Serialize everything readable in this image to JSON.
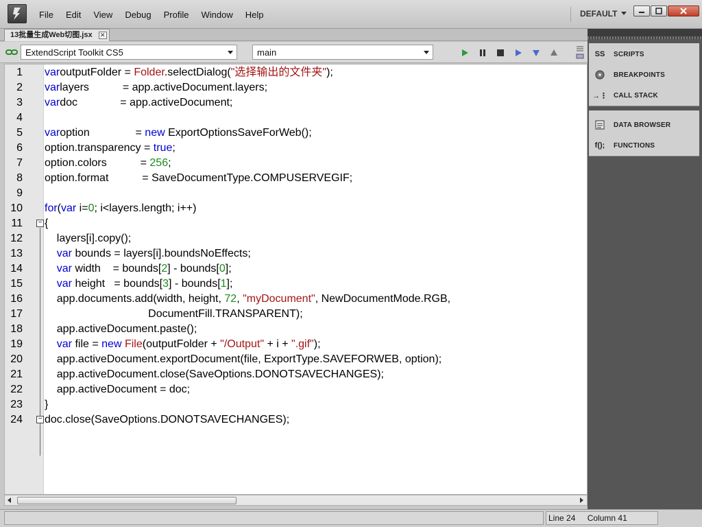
{
  "window": {
    "menu": [
      "File",
      "Edit",
      "View",
      "Debug",
      "Profile",
      "Window",
      "Help"
    ],
    "workspace": "DEFAULT"
  },
  "document": {
    "tab_title": "13批量生成Web切图.jsx",
    "target_app": "ExtendScript Toolkit CS5",
    "engine": "main"
  },
  "editor": {
    "lines": [
      {
        "n": "1",
        "tokens": [
          [
            "kw",
            "var"
          ],
          [
            "",
            "outputFolder = "
          ],
          [
            "cls",
            "Folder"
          ],
          [
            "",
            ".selectDialog("
          ],
          [
            "str",
            "\"选择输出的文件夹\""
          ],
          [
            "",
            ");"
          ]
        ]
      },
      {
        "n": "2",
        "tokens": [
          [
            "kw",
            "var"
          ],
          [
            "",
            "layers           = app.activeDocument.layers;"
          ]
        ]
      },
      {
        "n": "3",
        "tokens": [
          [
            "kw",
            "var"
          ],
          [
            "",
            "doc              = app.activeDocument;"
          ]
        ]
      },
      {
        "n": "4",
        "tokens": []
      },
      {
        "n": "5",
        "tokens": [
          [
            "kw",
            "var"
          ],
          [
            "",
            "option               = "
          ],
          [
            "kw",
            "new"
          ],
          [
            "",
            " ExportOptionsSaveForWeb();"
          ]
        ]
      },
      {
        "n": "6",
        "tokens": [
          [
            "",
            "option.transparency = "
          ],
          [
            "kw",
            "true"
          ],
          [
            "",
            ";"
          ]
        ]
      },
      {
        "n": "7",
        "tokens": [
          [
            "",
            "option.colors           = "
          ],
          [
            "num",
            "256"
          ],
          [
            "",
            ";"
          ]
        ]
      },
      {
        "n": "8",
        "tokens": [
          [
            "",
            "option.format           = SaveDocumentType.COMPUSERVEGIF;"
          ]
        ]
      },
      {
        "n": "9",
        "tokens": []
      },
      {
        "n": "10",
        "tokens": [
          [
            "kw",
            "for"
          ],
          [
            "",
            "("
          ],
          [
            "kw",
            "var"
          ],
          [
            "",
            " i="
          ],
          [
            "num",
            "0"
          ],
          [
            "",
            "; i<layers.length; i++)"
          ]
        ]
      },
      {
        "n": "11",
        "tokens": [
          [
            "",
            "{"
          ]
        ]
      },
      {
        "n": "12",
        "tokens": [
          [
            "",
            "    layers[i].copy();"
          ]
        ]
      },
      {
        "n": "13",
        "tokens": [
          [
            "",
            "    "
          ],
          [
            "kw",
            "var"
          ],
          [
            "",
            " bounds = layers[i].boundsNoEffects;"
          ]
        ]
      },
      {
        "n": "14",
        "tokens": [
          [
            "",
            "    "
          ],
          [
            "kw",
            "var"
          ],
          [
            "",
            " width    = bounds["
          ],
          [
            "num",
            "2"
          ],
          [
            "",
            "] - bounds["
          ],
          [
            "num",
            "0"
          ],
          [
            "",
            "];"
          ]
        ]
      },
      {
        "n": "15",
        "tokens": [
          [
            "",
            "    "
          ],
          [
            "kw",
            "var"
          ],
          [
            "",
            " height   = bounds["
          ],
          [
            "num",
            "3"
          ],
          [
            "",
            "] - bounds["
          ],
          [
            "num",
            "1"
          ],
          [
            "",
            "];"
          ]
        ]
      },
      {
        "n": "16",
        "tokens": [
          [
            "",
            "    app.documents.add(width, height, "
          ],
          [
            "num",
            "72"
          ],
          [
            "",
            ", "
          ],
          [
            "str",
            "\"myDocument\""
          ],
          [
            "",
            ", NewDocumentMode.RGB,"
          ]
        ]
      },
      {
        "n": "17",
        "tokens": [
          [
            "",
            "                                  DocumentFill.TRANSPARENT);"
          ]
        ]
      },
      {
        "n": "18",
        "tokens": [
          [
            "",
            "    app.activeDocument.paste();"
          ]
        ]
      },
      {
        "n": "19",
        "tokens": [
          [
            "",
            "    "
          ],
          [
            "kw",
            "var"
          ],
          [
            "",
            " file = "
          ],
          [
            "kw",
            "new"
          ],
          [
            "",
            " "
          ],
          [
            "cls",
            "File"
          ],
          [
            "",
            "(outputFolder + "
          ],
          [
            "str",
            "\"/Output\""
          ],
          [
            "",
            " + i + "
          ],
          [
            "str",
            "\".gif\""
          ],
          [
            "",
            ");"
          ]
        ]
      },
      {
        "n": "20",
        "tokens": [
          [
            "",
            "    app.activeDocument.exportDocument(file, ExportType.SAVEFORWEB, option);"
          ]
        ]
      },
      {
        "n": "21",
        "tokens": [
          [
            "",
            "    app.activeDocument.close(SaveOptions.DONOTSAVECHANGES);"
          ]
        ]
      },
      {
        "n": "22",
        "tokens": [
          [
            "",
            "    app.activeDocument = doc;"
          ]
        ]
      },
      {
        "n": "23",
        "tokens": [
          [
            "",
            "}"
          ]
        ]
      },
      {
        "n": "24",
        "tokens": [
          [
            "",
            "doc.close(SaveOptions.DONOTSAVECHANGES);"
          ]
        ]
      }
    ]
  },
  "panels": {
    "group1": [
      {
        "label": "SCRIPTS",
        "icon": "scripts-icon"
      },
      {
        "label": "BREAKPOINTS",
        "icon": "breakpoints-icon"
      },
      {
        "label": "CALL STACK",
        "icon": "call-stack-icon"
      }
    ],
    "group2": [
      {
        "label": "DATA BROWSER",
        "icon": "data-browser-icon"
      },
      {
        "label": "FUNCTIONS",
        "icon": "functions-icon"
      }
    ]
  },
  "status": {
    "line": "Line 24",
    "column": "Column 41"
  },
  "colors": {
    "keyword": "#0000d0",
    "class": "#a31515",
    "string": "#a31515",
    "number": "#1a8a1a"
  }
}
